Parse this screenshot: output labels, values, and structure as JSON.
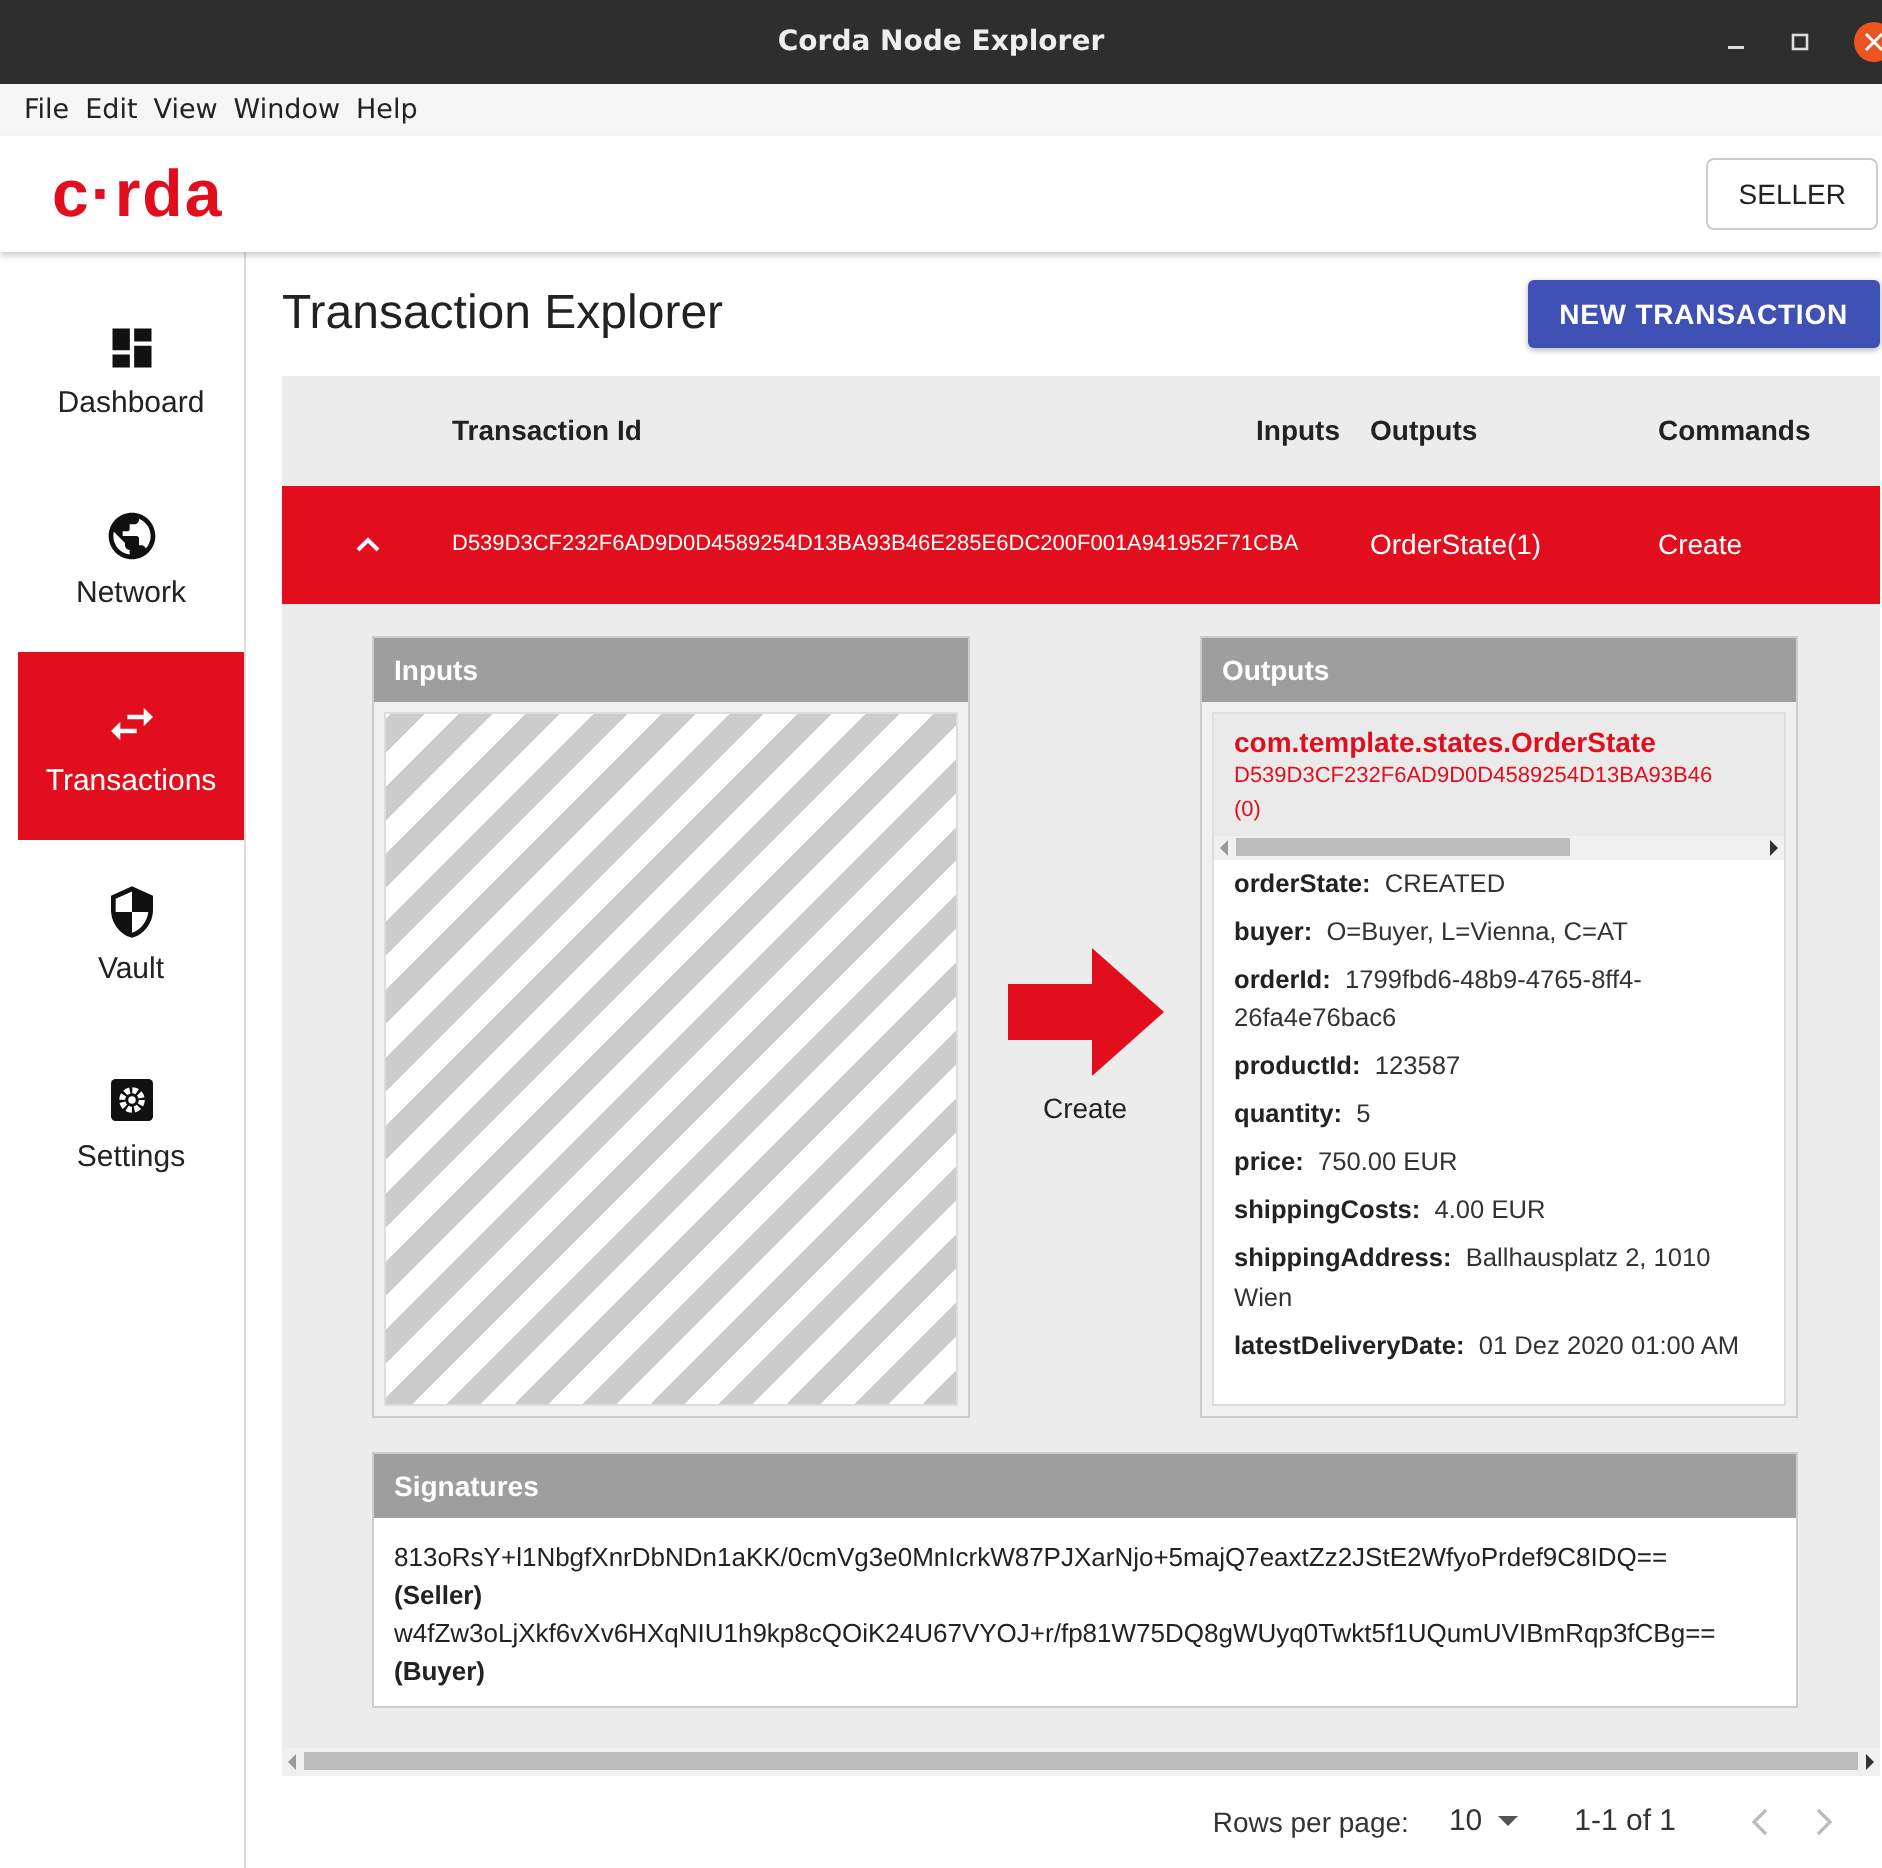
{
  "window": {
    "title": "Corda Node Explorer"
  },
  "menu": [
    "File",
    "Edit",
    "View",
    "Window",
    "Help"
  ],
  "header": {
    "logo": "c·rda",
    "user_button": "SELLER"
  },
  "sidebar": {
    "items": [
      {
        "label": "Dashboard",
        "selected": false
      },
      {
        "label": "Network",
        "selected": false
      },
      {
        "label": "Transactions",
        "selected": true
      },
      {
        "label": "Vault",
        "selected": false
      },
      {
        "label": "Settings",
        "selected": false
      }
    ]
  },
  "page_title": "Transaction Explorer",
  "new_button": "NEW TRANSACTION",
  "table": {
    "columns": [
      "Transaction Id",
      "Inputs",
      "Outputs",
      "Commands"
    ],
    "rows": [
      {
        "expanded": true,
        "transaction_id": "D539D3CF232F6AD9D0D4589254D13BA93B46E285E6DC200F001A941952F71CBA",
        "outputs": "OrderState(1)",
        "commands": "Create",
        "detail": {
          "inputs_title": "Inputs",
          "command": "Create",
          "outputs_title": "Outputs",
          "output": {
            "state_type": "com.template.states.OrderState",
            "state_ref": "D539D3CF232F6AD9D0D4589254D13BA93B46",
            "state_index": "(0)",
            "fields": [
              {
                "name": "orderState:",
                "value": "CREATED"
              },
              {
                "name": "buyer:",
                "value": "O=Buyer, L=Vienna, C=AT"
              },
              {
                "name": "orderId:",
                "value": "1799fbd6-48b9-4765-8ff4-26fa4e76bac6"
              },
              {
                "name": "productId:",
                "value": "123587"
              },
              {
                "name": "quantity:",
                "value": "5"
              },
              {
                "name": "price:",
                "value": "750.00 EUR"
              },
              {
                "name": "shippingCosts:",
                "value": "4.00 EUR"
              },
              {
                "name": "shippingAddress:",
                "value": "Ballhausplatz 2, 1010 Wien"
              },
              {
                "name": "latestDeliveryDate:",
                "value": "01 Dez 2020 01:00 AM"
              }
            ]
          },
          "signatures_title": "Signatures",
          "signatures": [
            {
              "key": "813oRsY+l1NbgfXnrDbNDn1aKK/0cmVg3e0MnIcrkW87PJXarNjo+5majQ7eaxtZz2JStE2WfyoPrdef9C8IDQ==",
              "party": "(Seller)"
            },
            {
              "key": "w4fZw3oLjXkf6vXv6HXqNIU1h9kp8cQOiK24U67VYOJ+r/fp81W75DQ8gWUyq0Twkt5f1UQumUVIBmRqp3fCBg==",
              "party": "(Buyer)"
            }
          ]
        }
      }
    ]
  },
  "pagination": {
    "rows_per_page_label": "Rows per page:",
    "rows_per_page": "10",
    "range": "1-1 of 1",
    "prev_disabled": true,
    "next_disabled": true
  }
}
